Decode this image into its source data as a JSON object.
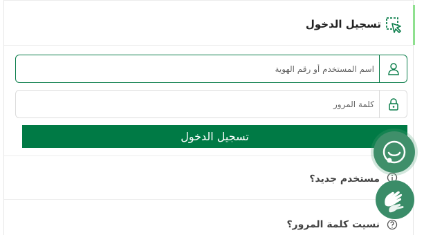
{
  "login": {
    "title": "تسجيل الدخول",
    "username_placeholder": "اسم المستخدم أو رقم الهوية",
    "password_placeholder": "كلمة المرور",
    "submit_label": "تسجيل الدخول"
  },
  "links": {
    "new_user": "مستخدم جديد؟",
    "forgot_password": "نسيت كلمة المرور؟"
  },
  "icons": {
    "header": "cursor-select-icon",
    "username": "user-icon",
    "password": "lock-icon",
    "new_user": "info-icon",
    "forgot_password": "help-icon",
    "chat": "chat-icon",
    "sign_language": "sign-language-icon"
  },
  "colors": {
    "primary": "#007a45",
    "accent": "#8fe08f",
    "fab": "#3f8f6a"
  }
}
